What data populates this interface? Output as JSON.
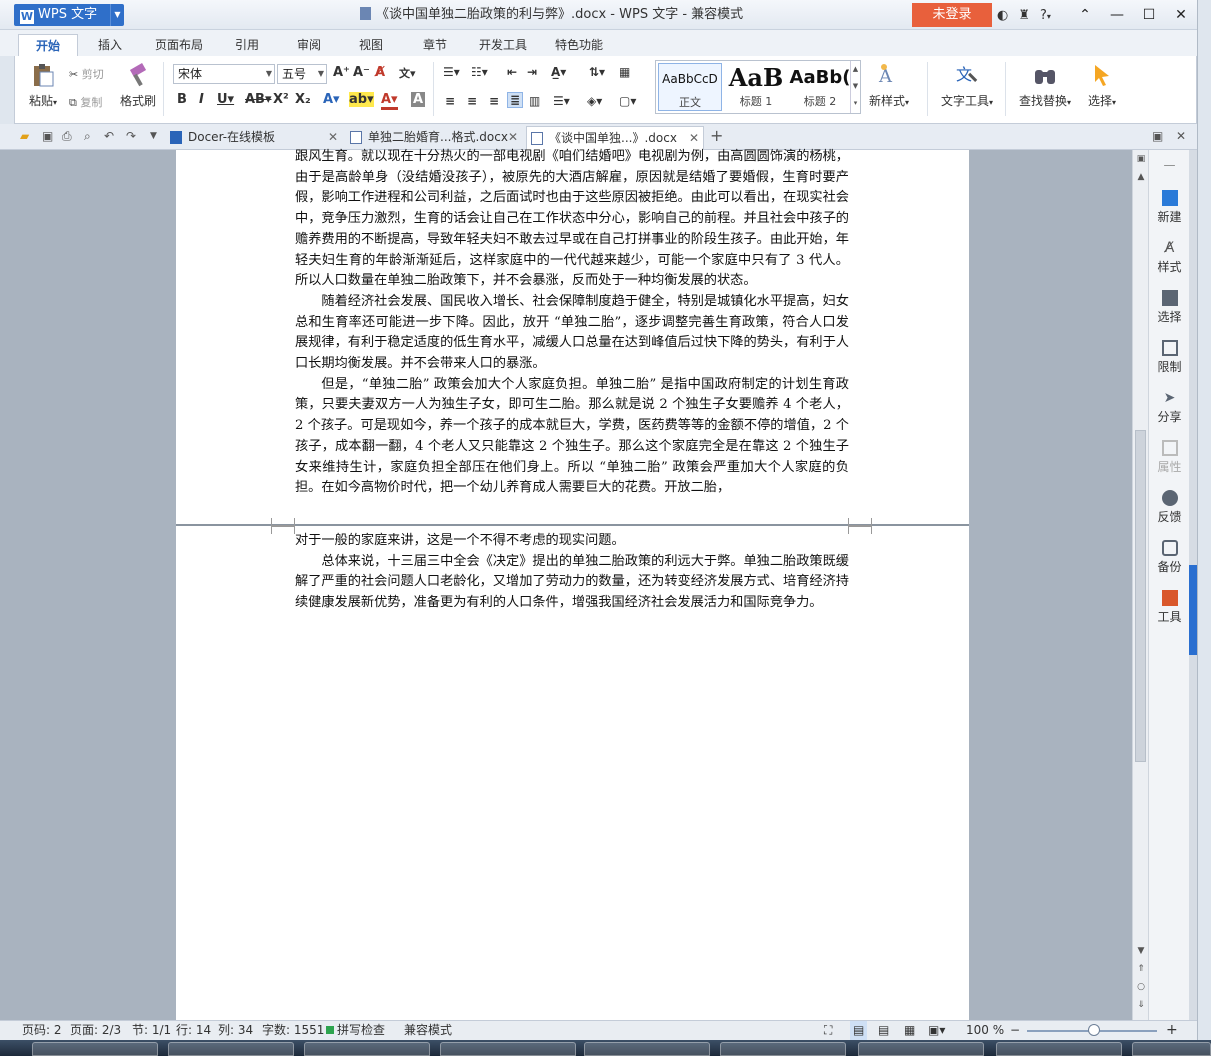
{
  "app": {
    "name": "WPS 文字",
    "window_title": "《谈中国单独二胎政策的利与弊》.docx - WPS 文字 - 兼容模式",
    "login_label": "未登录",
    "help_label": "?"
  },
  "ribbon_tabs": [
    "开始",
    "插入",
    "页面布局",
    "引用",
    "审阅",
    "视图",
    "章节",
    "开发工具",
    "特色功能"
  ],
  "ribbon": {
    "paste": "粘贴",
    "cut": "剪切",
    "copy": "复制",
    "format_painter": "格式刷",
    "font_name": "宋体",
    "font_size": "五号",
    "styles": [
      {
        "preview": "AaBbCcD",
        "label": "正文"
      },
      {
        "preview": "AaB",
        "label": "标题 1"
      },
      {
        "preview": "AaBb(",
        "label": "标题 2"
      }
    ],
    "new_style": "新样式",
    "text_tools": "文字工具",
    "find_replace": "查找替换",
    "select": "选择"
  },
  "doc_tabs": [
    {
      "label": "Docer-在线模板"
    },
    {
      "label": "单独二胎婚育...格式.docx"
    },
    {
      "label": "《谈中国单独...》.docx"
    }
  ],
  "document": {
    "page1_paragraphs": [
      "跟风生育。就以现在十分热火的一部电视剧《咱们结婚吧》电视剧为例，由高圆圆饰演的杨桃，由于是高龄单身（没结婚没孩子），被原先的大酒店解雇，原因就是结婚了要婚假，生育时要产假，影响工作进程和公司利益，之后面试时也由于这些原因被拒绝。由此可以看出，在现实社会中，竞争压力激烈，生育的话会让自己在工作状态中分心，影响自己的前程。并且社会中孩子的赡养费用的不断提高，导致年轻夫妇不敢去过早或在自己打拼事业的阶段生孩子。由此开始，年轻夫妇生育的年龄渐渐延后，这样家庭中的一代代越来越少，可能一个家庭中只有了 3 代人。所以人口数量在单独二胎政策下，并不会暴涨，反而处于一种均衡发展的状态。",
      "随着经济社会发展、国民收入增长、社会保障制度趋于健全，特别是城镇化水平提高，妇女总和生育率还可能进一步下降。因此，放开 “单独二胎”，逐步调整完善生育政策，符合人口发展规律，有利于稳定适度的低生育水平，减缓人口总量在达到峰值后过快下降的势头，有利于人口长期均衡发展。并不会带来人口的暴涨。",
      "但是，“单独二胎” 政策会加大个人家庭负担。单独二胎” 是指中国政府制定的计划生育政策，只要夫妻双方一人为独生子女，即可生二胎。那么就是说 2 个独生子女要赡养 4 个老人，2 个孩子。可是现如今，养一个孩子的成本就巨大，学费，医药费等等的金额不停的增值，2 个孩子，成本翻一翻，4 个老人又只能靠这 2 个独生子。那么这个家庭完全是在靠这 2 个独生子女来维持生计，家庭负担全部压在他们身上。所以 “单独二胎” 政策会严重加大个人家庭的负担。在如今高物价时代，把一个幼儿养育成人需要巨大的花费。开放二胎，"
    ],
    "page2_paragraphs": [
      "对于一般的家庭来讲，这是一个不得不考虑的现实问题。",
      "总体来说，十三届三中全会《决定》提出的单独二胎政策的利远大于弊。单独二胎政策既缓解了严重的社会问题人口老龄化，又增加了劳动力的数量，还为转变经济发展方式、培育经济持续健康发展新优势，准备更为有利的人口条件，增强我国经济社会发展活力和国际竞争力。"
    ]
  },
  "taskpane": [
    "新建",
    "样式",
    "选择",
    "限制",
    "分享",
    "属性",
    "反馈",
    "备份",
    "工具"
  ],
  "status": {
    "page_code": "页码: 2",
    "pages": "页面: 2/3",
    "section": "节: 1/1",
    "row": "行: 14",
    "col": "列: 34",
    "words": "字数: 1551",
    "spellcheck": "拼写检查",
    "compat": "兼容模式",
    "zoom": "100 %"
  },
  "colors": {
    "accent": "#2f6fc9",
    "login": "#e8603c"
  }
}
